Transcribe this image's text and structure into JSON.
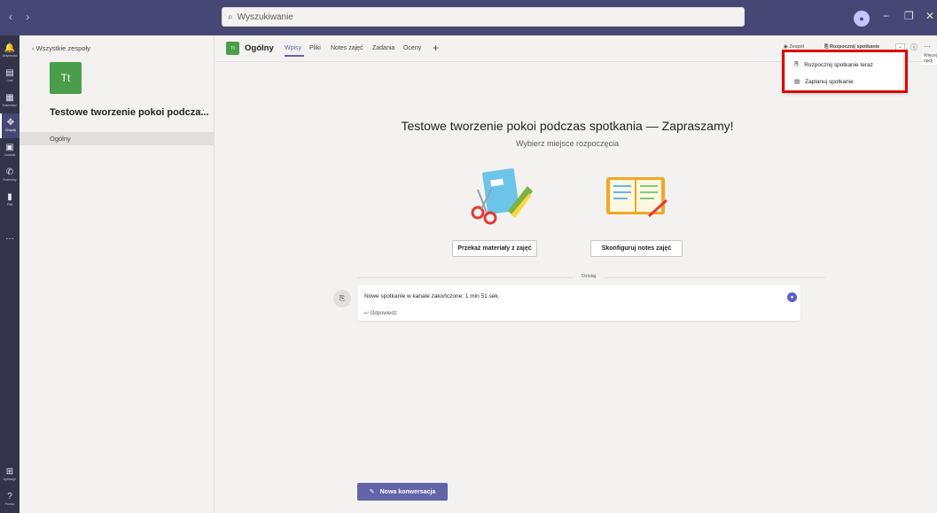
{
  "search": {
    "placeholder": "Wyszukiwanie"
  },
  "window": {
    "minimize": "−",
    "restore": "❐",
    "close": "✕"
  },
  "nav": {
    "arrows": "‹ ›"
  },
  "rail": [
    {
      "label": "Aktywność",
      "icon": "bell-icon",
      "glyph": "🔔"
    },
    {
      "label": "Czat",
      "icon": "chat-icon",
      "glyph": "▤"
    },
    {
      "label": "Kalendarz",
      "icon": "calendar-icon",
      "glyph": "▦"
    },
    {
      "label": "Zespoły",
      "icon": "teams-icon",
      "glyph": "✥"
    },
    {
      "label": "Zadania",
      "icon": "assignments-icon",
      "glyph": "▣"
    },
    {
      "label": "Rozmowy",
      "icon": "phone-icon",
      "glyph": "✆"
    },
    {
      "label": "Pliki",
      "icon": "files-icon",
      "glyph": "▮"
    },
    {
      "label": "",
      "icon": "more-icon",
      "glyph": "…"
    }
  ],
  "rail_bottom": [
    {
      "label": "Aplikacje",
      "icon": "apps-icon",
      "glyph": "⊞"
    },
    {
      "label": "Pomoc",
      "icon": "help-icon",
      "glyph": "?"
    }
  ],
  "sidebar": {
    "back_label": "Wszystkie zespoły",
    "team_initials": "Tt",
    "team_name": "Testowe tworzenie pokoi podcza...",
    "team_more": "···",
    "channel": "Ogólny"
  },
  "header": {
    "channel_initials": "Tt",
    "channel_name": "Ogólny",
    "tabs": [
      "Wpisy",
      "Pliki",
      "Notes zajęć",
      "Zadania",
      "Oceny"
    ],
    "team_btn": "Zespół",
    "meet_btn": "Rozpocznij spotkanie",
    "more_options_tooltip": "Więcej opcji"
  },
  "dropdown": {
    "items": [
      "Rozpocznij spotkanie teraz",
      "Zaplanuj spotkanie"
    ]
  },
  "welcome": {
    "title": "Testowe tworzenie pokoi podczas spotkania — Zapraszamy!",
    "subtitle": "Wybierz miejsce rozpoczęcia",
    "btn_materials": "Przekaż materiały z zajęć",
    "btn_notebook": "Skonfiguruj notes zajęć"
  },
  "feed": {
    "date_label": "Dzisiaj",
    "message": "Nowe spotkanie w kanale zakończone: 1 min 51 sek.",
    "reply": "Odpowiedz"
  },
  "compose": {
    "new_conversation": "Nowa konwersacja"
  },
  "colors": {
    "accent": "#6264a7",
    "team_tile": "#4a9d4a",
    "highlight": "#e00000",
    "rail": "#33344a"
  }
}
